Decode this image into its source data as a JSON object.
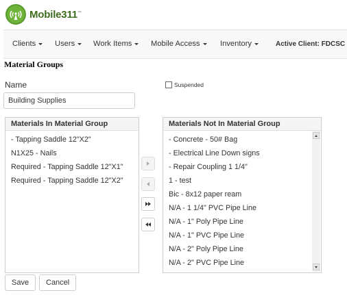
{
  "brand": {
    "name": "Mobile311",
    "trademark": "™",
    "logo_icon": "signal-tower-icon",
    "color": "#3f6c1e"
  },
  "nav": {
    "items": [
      {
        "label": "Clients"
      },
      {
        "label": "Users"
      },
      {
        "label": "Work Items"
      },
      {
        "label": "Mobile Access"
      },
      {
        "label": "Inventory"
      }
    ],
    "active_client": "Active Client:  FDCSC"
  },
  "page": {
    "title": "Material Groups",
    "name_label": "Name",
    "name_value": "Building Supplies",
    "suspended_label": "Suspended",
    "suspended_checked": false
  },
  "in_group": {
    "header": "Materials In Material Group",
    "items": [
      "- Tapping Saddle 12\"X2\"",
      "N1X25 - Nails",
      "Required - Tapping Saddle 12\"X1\"",
      "Required - Tapping Saddle 12\"X2\""
    ]
  },
  "not_in_group": {
    "header": "Materials Not In Material Group",
    "items": [
      "- Concrete - 50# Bag",
      "- Electrical Line Down signs",
      "- Repair Coupling 1 1/4\"",
      "1 - test",
      "Bic - 8x12 paper ream",
      "N/A - 1 1/4\" PVC Pipe Line",
      "N/A - 1\" Poly Pipe Line",
      "N/A - 1\" PVC Pipe Line",
      "N/A - 2\" Poly Pipe Line",
      "N/A - 2\" PVC Pipe Line"
    ]
  },
  "move_buttons": {
    "icons": [
      "move-right-icon",
      "move-left-icon",
      "move-all-right-icon",
      "move-all-left-icon"
    ]
  },
  "actions": {
    "save": "Save",
    "cancel": "Cancel"
  }
}
